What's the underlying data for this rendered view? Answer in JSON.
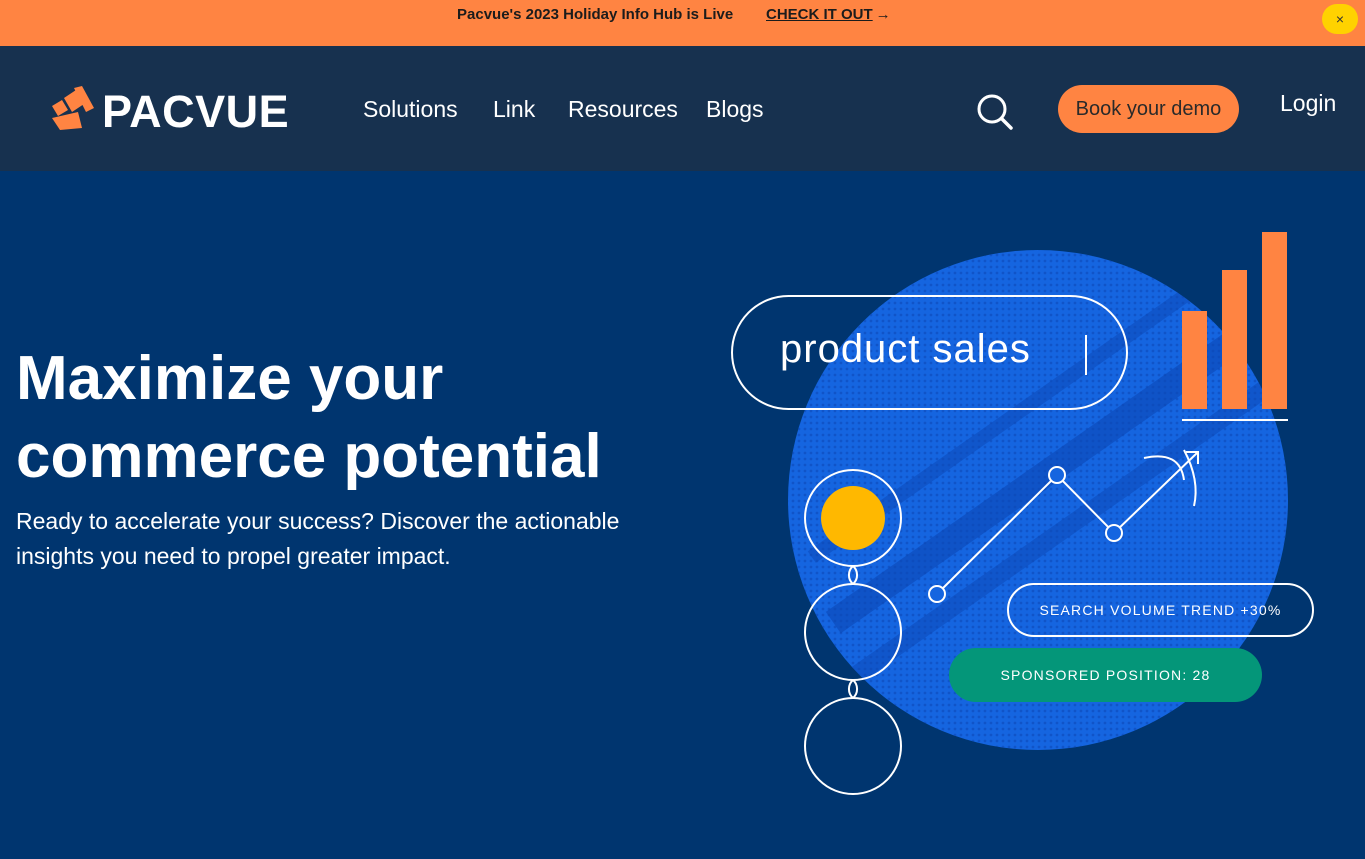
{
  "announcement": {
    "text": "Pacvue's 2023 Holiday Info Hub is Live",
    "cta_label": "CHECK IT OUT",
    "cta_arrow": "→",
    "close_symbol": "×"
  },
  "header": {
    "logo_text": "PACVUE",
    "nav": [
      {
        "label": "Solutions"
      },
      {
        "label": "Link"
      },
      {
        "label": "Resources"
      },
      {
        "label": "Blogs"
      }
    ],
    "search_icon": "search-icon",
    "demo_button": "Book your demo",
    "login": "Login"
  },
  "hero": {
    "title_line1": "Maximize your",
    "title_line2": "commerce potential",
    "subtitle": "Ready to accelerate your success? Discover the actionable insights you need to propel greater impact."
  },
  "illustration": {
    "search_pill": "product sales",
    "search_trend": "SEARCH VOLUME TREND +30%",
    "sponsored_position": "SPONSORED POSITION: 28"
  },
  "colors": {
    "announcement_bg": "#ff8442",
    "header_bg": "#17314f",
    "hero_bg": "#00356f",
    "accent_orange": "#ff8442",
    "accent_yellow": "#ffb800",
    "accent_green": "#049679",
    "globe_blue": "#1565e0"
  }
}
